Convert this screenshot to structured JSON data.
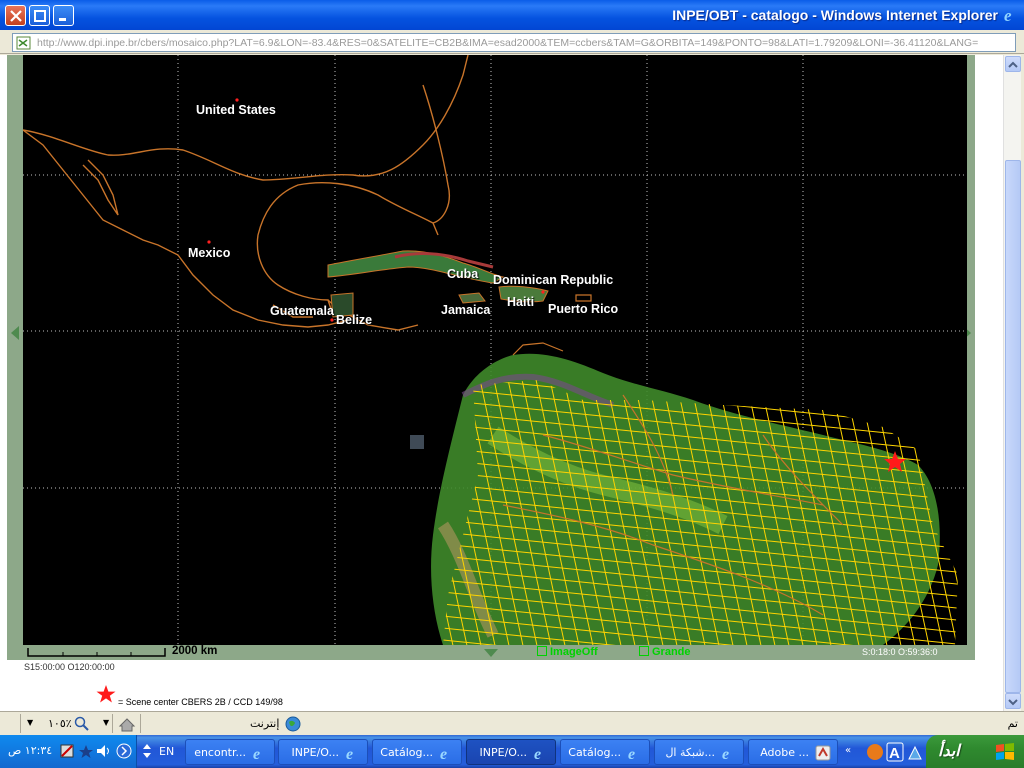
{
  "window": {
    "title": "INPE/OBT - catalogo - Windows Internet Explorer"
  },
  "address": {
    "url": "http://www.dpi.inpe.br/cbers/mosaico.php?LAT=6.9&LON=-83.4&RES=0&SATELITE=CB2B&IMA=esad2000&TEM=ccbers&TAM=G&ORBITA=149&PONTO=98&LATI=1.79209&LONI=-36.41120&LANG="
  },
  "map": {
    "labels": {
      "united_states": "United States",
      "mexico": "Mexico",
      "cuba": "Cuba",
      "dominican_republic": "Dominican Republic",
      "haiti": "Haiti",
      "guatemala": "Guatemala",
      "belize": "Belize",
      "jamaica": "Jamaica",
      "puerto_rico": "Puerto Rico"
    },
    "scale_label": "2000 km",
    "coords_right": "S:0:18:0 O:59:36:0",
    "checkbox_imageoff": "ImageOff",
    "checkbox_grande": "Grande",
    "coords_left": "S15:00:00 O120:00:00",
    "legend_text": "= Scene center CBERS 2B / CCD 149/98",
    "colors": {
      "grid": "#ffd400",
      "borders": "#c8742a",
      "star": "#ff1a1a"
    }
  },
  "statusbar": {
    "done": "تم",
    "zone": "إنترنت",
    "zoom": "١٠٥٪"
  },
  "taskbar": {
    "start_label": "ابدأ",
    "tasks": [
      {
        "label": "Adobe ..."
      },
      {
        "label": "شبكة ال..."
      },
      {
        "label": "Catálog..."
      },
      {
        "label": "INPE/O..."
      },
      {
        "label": "Catálog..."
      },
      {
        "label": "INPE/O..."
      },
      {
        "label": "encontr..."
      }
    ],
    "lang": "EN",
    "clock": "١٢:٣٤ ص"
  }
}
